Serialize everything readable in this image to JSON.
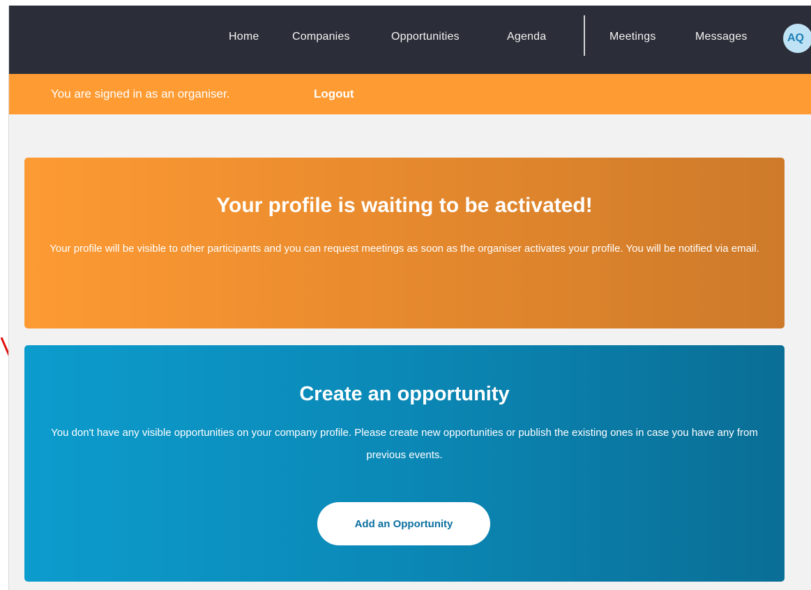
{
  "nav": {
    "items": [
      {
        "label": "Home"
      },
      {
        "label": "Companies"
      },
      {
        "label": "Opportunities"
      },
      {
        "label": "Agenda"
      },
      {
        "label": "Meetings"
      },
      {
        "label": "Messages"
      }
    ],
    "avatar_initials": "AQ"
  },
  "banner": {
    "text": "You are signed in as an organiser.",
    "logout_label": "Logout"
  },
  "activation_card": {
    "title": "Your profile is waiting to be activated!",
    "text": "Your profile will be visible to other participants and you can request meetings as soon as the organiser activates your profile. You will be notified via email."
  },
  "opportunity_card": {
    "title": "Create an opportunity",
    "text": "You don't have any visible opportunities on your company profile. Please create new opportunities or publish the existing ones in case you have any from previous events.",
    "button_label": "Add an Opportunity"
  },
  "annotation": {
    "icon": "red-arrow-icon",
    "color": "#e01010"
  },
  "colors": {
    "nav_bg": "#2b2e38",
    "banner_bg": "#ff9b33",
    "activation_gradient": [
      "#fd9a33",
      "#cd7a2a"
    ],
    "opportunity_gradient": [
      "#0c9ccd",
      "#0a6e95"
    ],
    "avatar_bg": "#bfe2f4"
  }
}
